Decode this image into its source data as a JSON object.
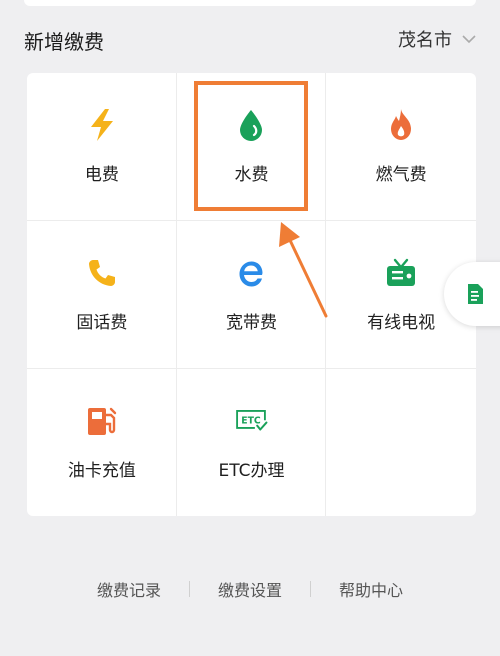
{
  "header": {
    "title": "新增缴费",
    "city": "茂名市",
    "city_dropdown_icon": "chevron-down-icon"
  },
  "services": [
    {
      "label": "电费",
      "icon": "lightning-icon",
      "color": "#f5b21a"
    },
    {
      "label": "水费",
      "icon": "water-drop-icon",
      "color": "#1aa15a"
    },
    {
      "label": "燃气费",
      "icon": "flame-icon",
      "color": "#ec6d3a"
    },
    {
      "label": "固话费",
      "icon": "phone-icon",
      "color": "#f5b21a"
    },
    {
      "label": "宽带费",
      "icon": "ie-browser-icon",
      "color": "#2a8be8"
    },
    {
      "label": "有线电视",
      "icon": "tv-icon",
      "color": "#1aa15a"
    },
    {
      "label": "油卡充值",
      "icon": "fuel-pump-icon",
      "color": "#ec6d3a"
    },
    {
      "label": "ETC办理",
      "icon": "etc-icon",
      "color": "#1aa15a"
    }
  ],
  "footer": {
    "links": [
      "缴费记录",
      "缴费设置",
      "帮助中心"
    ]
  },
  "colors": {
    "highlight": "#ef7d35",
    "background": "#efeff1"
  }
}
